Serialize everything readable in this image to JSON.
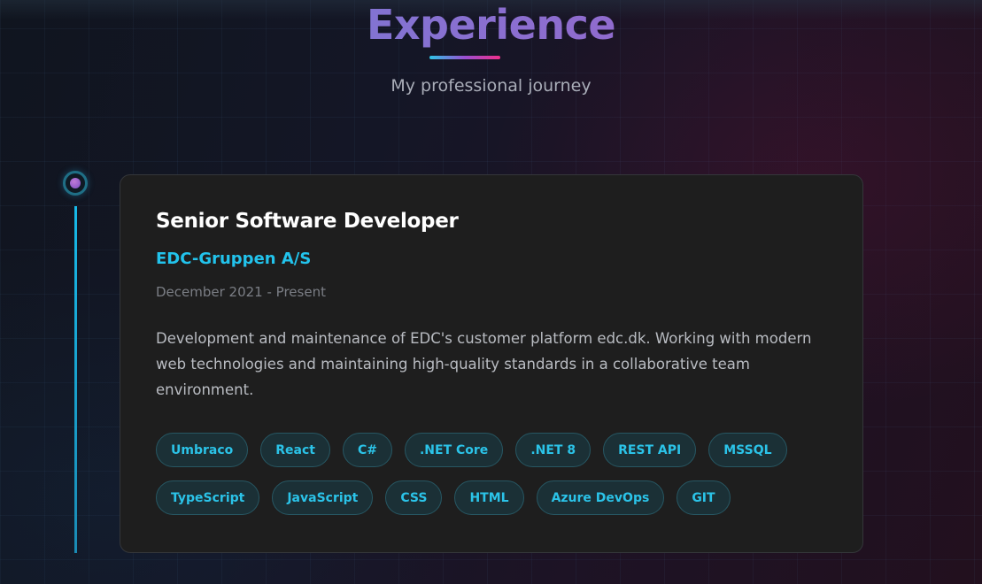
{
  "section": {
    "title": "Experience",
    "subtitle": "My professional journey"
  },
  "experience": {
    "title": "Senior Software Developer",
    "company": "EDC-Gruppen A/S",
    "dates": "December 2021 - Present",
    "description": "Development and maintenance of EDC's customer platform edc.dk. Working with modern web technologies and maintaining high-quality standards in a collaborative team environment.",
    "tags": [
      "Umbraco",
      "React",
      "C#",
      ".NET Core",
      ".NET 8",
      "REST API",
      "MSSQL",
      "TypeScript",
      "JavaScript",
      "CSS",
      "HTML",
      "Azure DevOps",
      "GIT"
    ]
  },
  "colors": {
    "accent": "#22c3ec",
    "title_gradient_start": "#6b7fd6",
    "title_gradient_end": "#a15fc6",
    "card_background": "#1e1e1e"
  }
}
